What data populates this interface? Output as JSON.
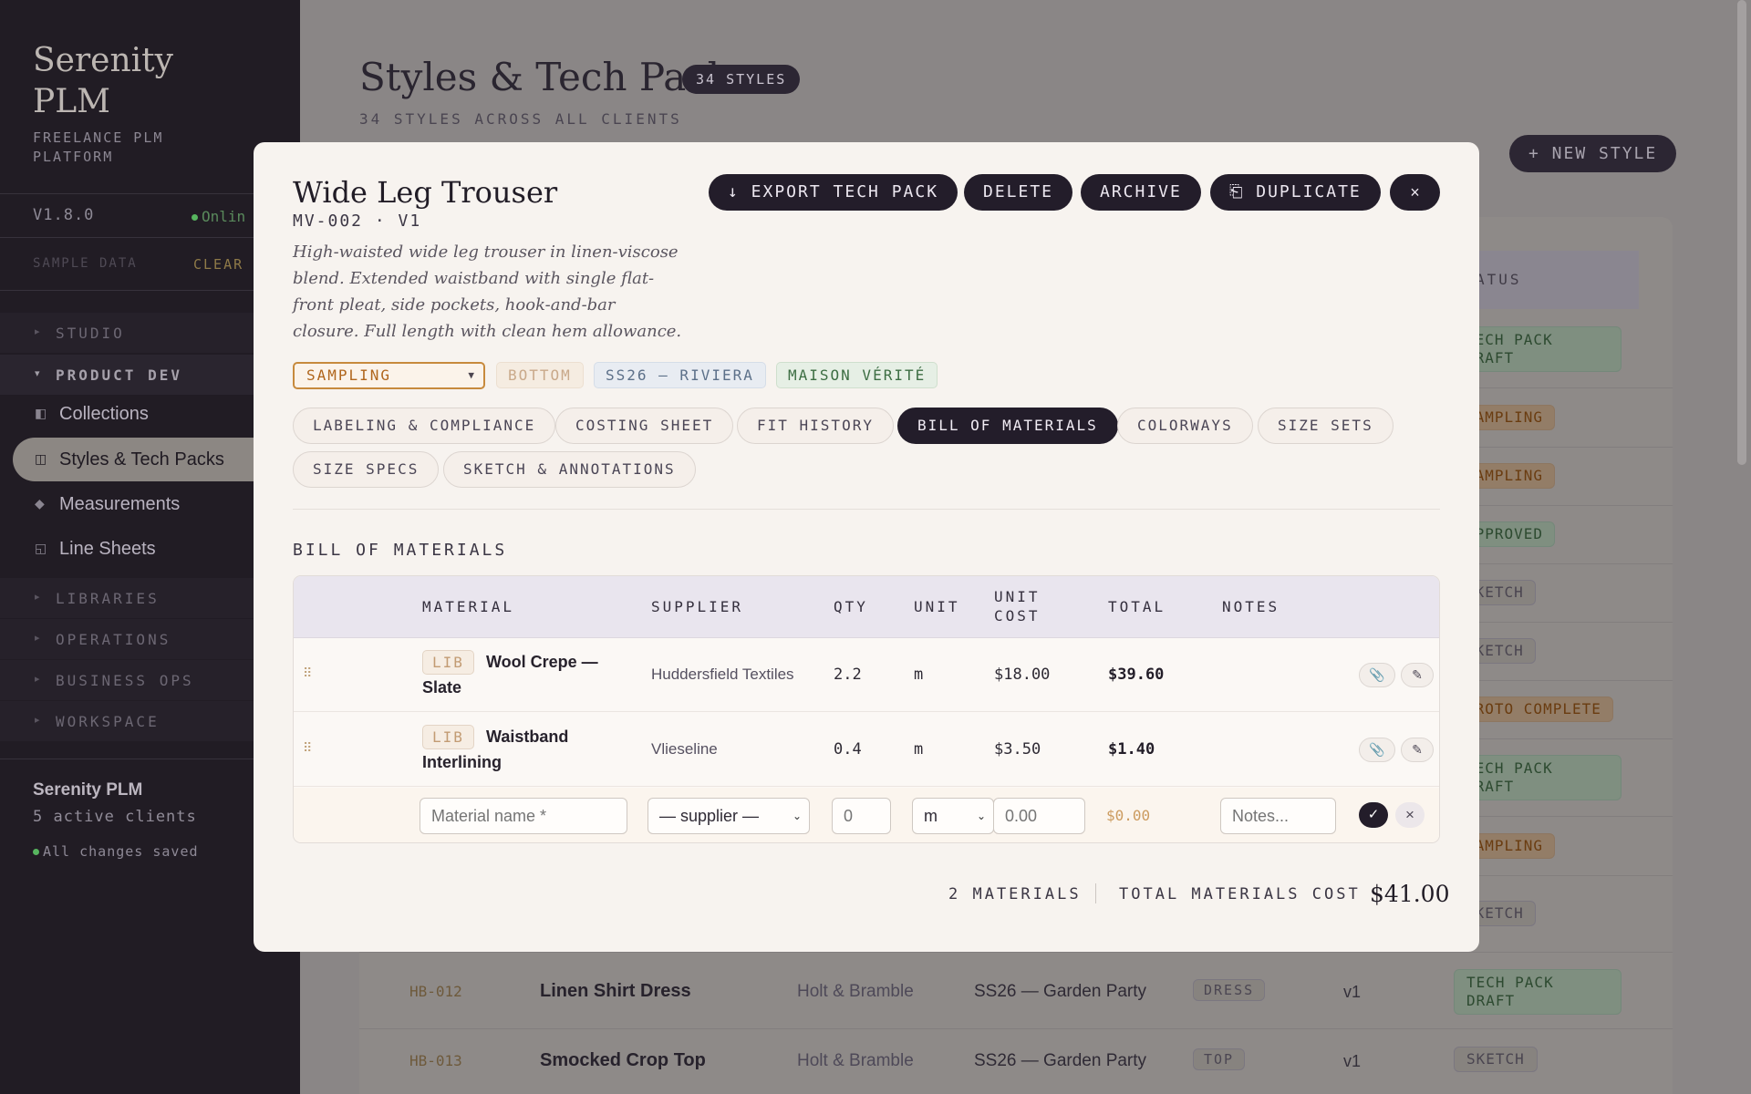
{
  "sidebar": {
    "brand_line1": "Serenity",
    "brand_line2": "PLM",
    "subtitle": "FREELANCE PLM PLATFORM",
    "version": "V1.8.0",
    "online": "Onlin",
    "sample_data": "SAMPLE DATA",
    "clear": "CLEAR",
    "sections": {
      "studio": "STUDIO",
      "product_dev": "PRODUCT DEV",
      "libraries": "LIBRARIES",
      "operations": "OPERATIONS",
      "business_ops": "BUSINESS OPS",
      "workspace": "WORKSPACE"
    },
    "items": [
      {
        "label": "Collections",
        "icon": "collections-icon"
      },
      {
        "label": "Styles & Tech Packs",
        "icon": "styles-icon"
      },
      {
        "label": "Measurements",
        "icon": "measurements-icon"
      },
      {
        "label": "Line Sheets",
        "icon": "line-sheets-icon"
      }
    ],
    "footer": {
      "name": "Serenity PLM",
      "clients": "5 active clients",
      "saved": "All changes saved"
    }
  },
  "page": {
    "title": "Styles & Tech Packs",
    "badge": "34 STYLES",
    "subtitle": "34 STYLES ACROSS ALL CLIENTS",
    "new_style": "+ NEW STYLE",
    "status_header": "ATUS",
    "status_badges": [
      "TECH PACK DRAFT",
      "SAMPLING",
      "SAMPLING",
      "APPROVED",
      "SKETCH",
      "SKETCH",
      "PROTO COMPLETE",
      "TECH PACK DRAFT",
      "SAMPLING",
      "SKETCH"
    ],
    "visible_rows": [
      {
        "code": "HB-012",
        "name": "Linen Shirt Dress",
        "client": "Holt & Bramble",
        "collection": "SS26 — Garden Party",
        "category": "DRESS",
        "version": "v1",
        "status": "TECH PACK DRAFT"
      },
      {
        "code": "HB-013",
        "name": "Smocked Crop Top",
        "client": "Holt & Bramble",
        "collection": "SS26 — Garden Party",
        "category": "TOP",
        "version": "v1",
        "status": "SKETCH"
      }
    ]
  },
  "modal": {
    "title": "Wide Leg Trouser",
    "code": "MV-002 · V1",
    "description": "High-waisted wide leg trouser in linen-viscose blend. Extended waistband with single flat-front pleat, side pockets, hook-and-bar closure. Full length with clean hem allowance.",
    "buttons": {
      "export": "↓ EXPORT TECH PACK",
      "delete": "DELETE",
      "archive": "ARCHIVE",
      "duplicate": "⎗ DUPLICATE",
      "close": "×"
    },
    "status_value": "SAMPLING",
    "tags": {
      "category": "BOTTOM",
      "season": "SS26 — RIVIERA",
      "client": "MAISON VÉRITÉ"
    },
    "tabs": [
      "LABELING & COMPLIANCE",
      "COSTING SHEET",
      "FIT HISTORY",
      "BILL OF MATERIALS",
      "COLORWAYS",
      "SIZE SETS",
      "SIZE SPECS",
      "SKETCH & ANNOTATIONS"
    ],
    "active_tab": "BILL OF MATERIALS",
    "bom": {
      "heading": "BILL OF MATERIALS",
      "columns": {
        "material": "MATERIAL",
        "supplier": "SUPPLIER",
        "qty": "QTY",
        "unit": "UNIT",
        "unit_cost_1": "UNIT",
        "unit_cost_2": "COST",
        "total": "TOTAL",
        "notes": "NOTES"
      },
      "rows": [
        {
          "lib": "LIB",
          "name": "Wool Crepe — Slate",
          "supplier": "Huddersfield Textiles",
          "qty": "2.2",
          "unit": "m",
          "unit_cost": "$18.00",
          "total": "$39.60"
        },
        {
          "lib": "LIB",
          "name": "Waistband Interlining",
          "supplier": "Vlieseline",
          "qty": "0.4",
          "unit": "m",
          "unit_cost": "$3.50",
          "total": "$1.40"
        }
      ],
      "new_row": {
        "material_placeholder": "Material name *",
        "supplier_value": "— supplier —",
        "qty_placeholder": "0",
        "unit_value": "m",
        "cost_placeholder": "0.00",
        "total": "$0.00",
        "notes_placeholder": "Notes..."
      },
      "summary": {
        "count": "2 MATERIALS",
        "label": "TOTAL MATERIALS COST",
        "value": "$41.00"
      }
    }
  },
  "colors": {
    "sidebar_bg": "#211c24",
    "accent_dark": "#231d2a",
    "status_sampling": "#c78a3d",
    "online_green": "#57b55f"
  }
}
